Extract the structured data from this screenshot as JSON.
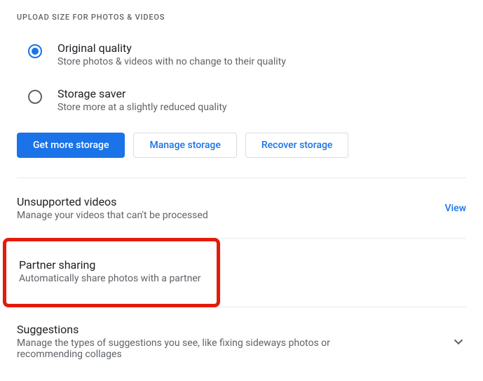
{
  "upload": {
    "header": "UPLOAD SIZE FOR PHOTOS & VIDEOS",
    "options": {
      "original_title": "Original quality",
      "original_desc": "Store photos & videos with no change to their quality",
      "saver_title": "Storage saver",
      "saver_desc": "Store more at a slightly reduced quality"
    },
    "buttons": {
      "get_more": "Get more storage",
      "manage": "Manage storage",
      "recover": "Recover storage"
    }
  },
  "unsupported": {
    "title": "Unsupported videos",
    "desc": "Manage your videos that can't be processed",
    "view": "View"
  },
  "partner": {
    "title": "Partner sharing",
    "desc": "Automatically share photos with a partner"
  },
  "suggestions": {
    "title": "Suggestions",
    "desc": "Manage the types of suggestions you see, like fixing sideways photos or recommending collages"
  }
}
